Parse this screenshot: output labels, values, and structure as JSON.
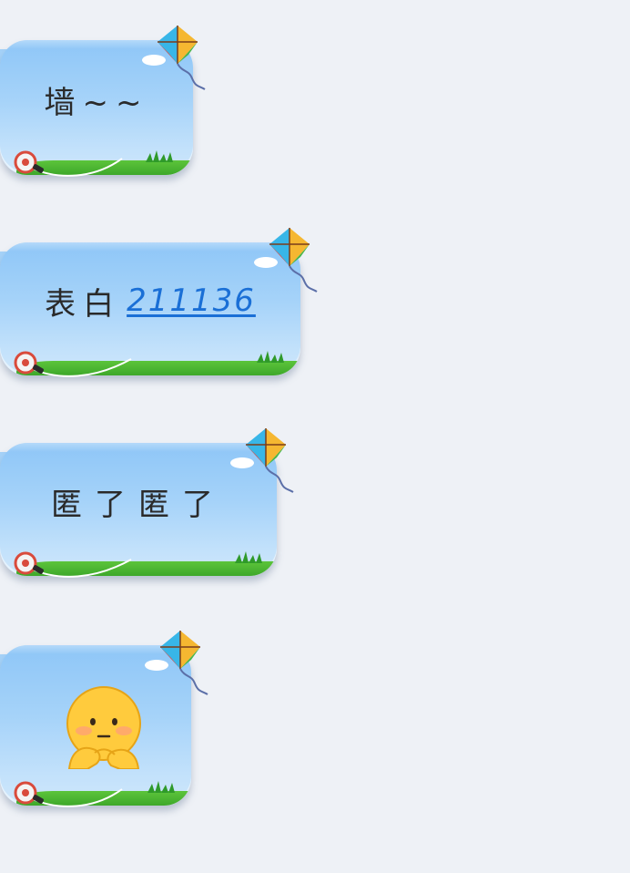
{
  "messages": [
    {
      "id": "m1",
      "type": "text",
      "text": "墙~~"
    },
    {
      "id": "m2",
      "type": "text",
      "text": "表白",
      "link": "211136"
    },
    {
      "id": "m3",
      "type": "text",
      "text": "匿了匿了"
    },
    {
      "id": "m4",
      "type": "emoji",
      "emoji": "shy-thinking-face-emoji"
    }
  ],
  "colors": {
    "background": "#eef1f6",
    "bubble_top": "#8ec6f7",
    "bubble_bottom": "#cfe7fb",
    "grass": "#3ea82b",
    "link": "#1a6fd6",
    "emoji_face": "#ffcb3d"
  },
  "icons": [
    "kite-icon",
    "kite-spool-icon",
    "grass-icon",
    "cloud-icon"
  ]
}
